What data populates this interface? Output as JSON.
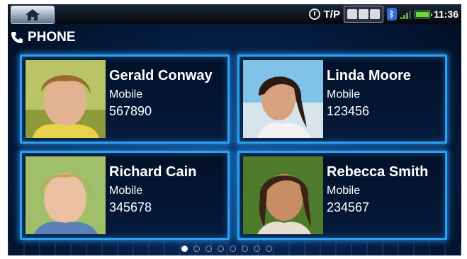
{
  "status_bar": {
    "home_icon": "home-icon",
    "tp_label": "T/P",
    "time": "11:36",
    "bluetooth_symbol": "ᛒ"
  },
  "header": {
    "title": "PHONE",
    "icon": "phone-handset-icon"
  },
  "contacts": [
    {
      "name": "Gerald Conway",
      "type": "Mobile",
      "number": "567890",
      "photo": "contact-photo-icon"
    },
    {
      "name": "Linda Moore",
      "type": "Mobile",
      "number": "123456",
      "photo": "contact-photo-icon"
    },
    {
      "name": "Richard Cain",
      "type": "Mobile",
      "number": "345678",
      "photo": "contact-photo-icon"
    },
    {
      "name": "Rebecca Smith",
      "type": "Mobile",
      "number": "234567",
      "photo": "contact-photo-icon"
    }
  ],
  "pagination": {
    "pages": 8,
    "current": 1
  },
  "colors": {
    "accent": "#2aa2ef",
    "background": "#06214a",
    "battery": "#6bd83a"
  }
}
